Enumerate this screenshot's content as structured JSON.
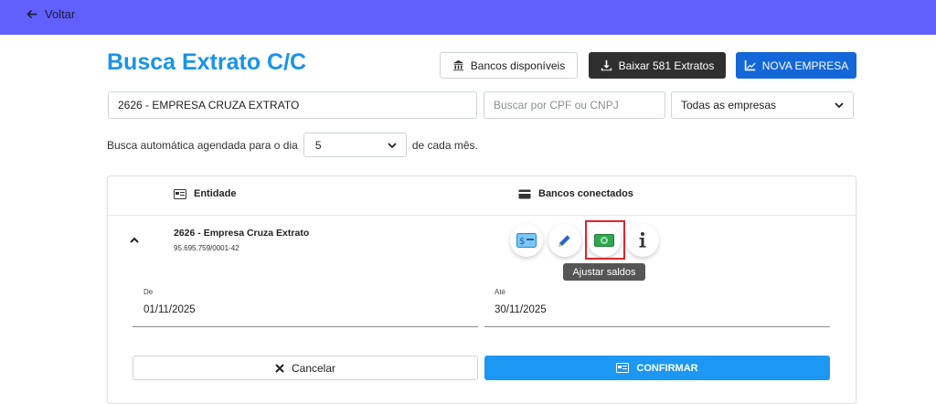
{
  "nav": {
    "back_label": "Voltar"
  },
  "page": {
    "title": "Busca Extrato C/C"
  },
  "toolbar": {
    "banks_label": "Bancos disponíveis",
    "download_label": "Baixar 581 Extratos",
    "new_company_label": "NOVA EMPRESA"
  },
  "filters": {
    "company_value": "2626 - EMPRESA CRUZA EXTRATO",
    "cpf_placeholder": "Buscar por CPF ou CNPJ",
    "company_scope_value": "Todas as empresas"
  },
  "schedule": {
    "prefix": "Busca automática agendada para o dia",
    "day_value": "5",
    "suffix": "de cada mês."
  },
  "table": {
    "col_entity": "Entidade",
    "col_banks": "Bancos conectados"
  },
  "entity": {
    "name": "2626 - Empresa Cruza Extrato",
    "document": "95.695.759/0001-42",
    "actions": [
      "money-card-icon",
      "pencil-icon",
      "banknote-icon",
      "info-icon"
    ],
    "tooltip": "Ajustar saldos"
  },
  "period": {
    "from_label": "De",
    "from_value": "01/11/2025",
    "to_label": "Até",
    "to_value": "30/11/2025"
  },
  "actions": {
    "cancel_label": "Cancelar",
    "confirm_label": "CONFIRMAR"
  },
  "colors": {
    "topbar": "#6160ff",
    "title": "#1a93e8",
    "primary": "#1467d8",
    "confirm": "#1c97f3",
    "highlight": "#e0242a"
  }
}
